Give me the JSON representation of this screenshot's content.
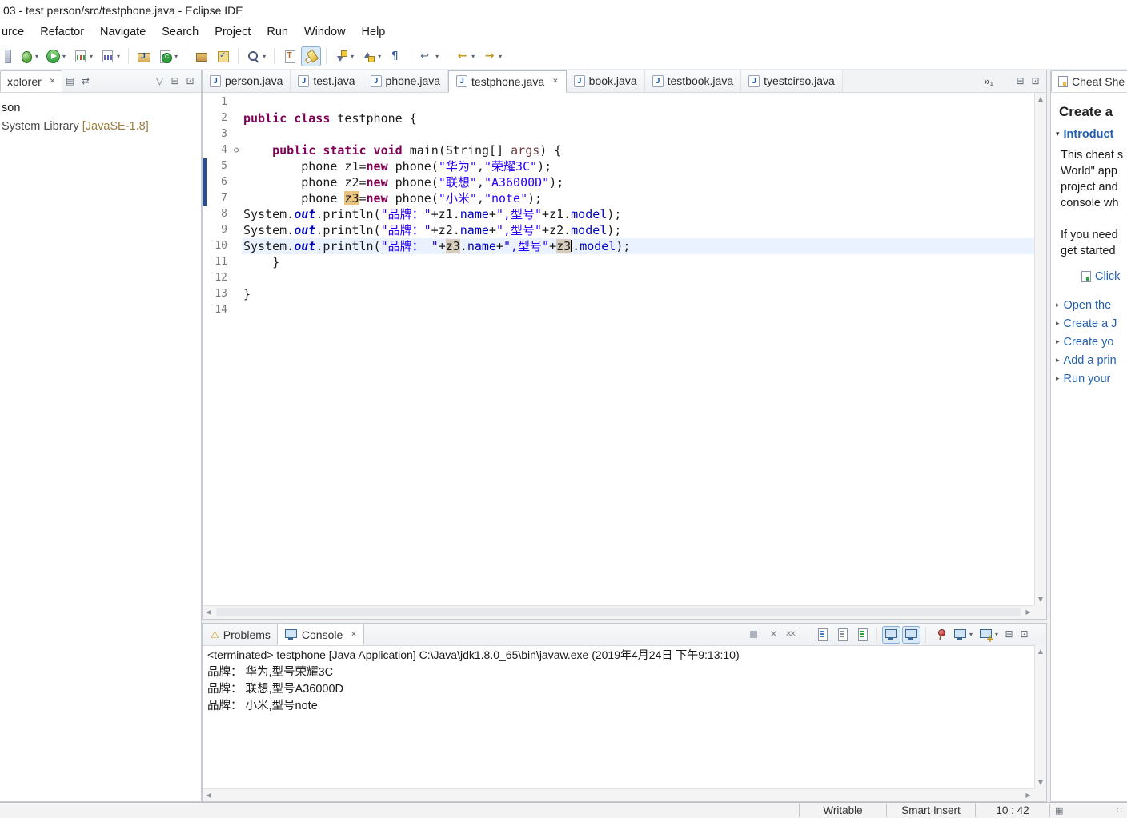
{
  "colors": {
    "keyword": "#7f0055",
    "string": "#2a00ff",
    "field": "#0000c0",
    "param": "#6a3e3e",
    "current_line": "#e9f2fe",
    "occurrence": "#d6cdbc",
    "occurrence_write": "#eac37e",
    "link": "#2361ae",
    "accent": "#3b6ea5"
  },
  "window": {
    "title": "03 - test person/src/testphone.java - Eclipse IDE"
  },
  "menubar": {
    "items": [
      "urce",
      "Refactor",
      "Navigate",
      "Search",
      "Project",
      "Run",
      "Window",
      "Help"
    ]
  },
  "icons": {
    "minimize": "⊟",
    "maximize": "⊡",
    "close": "✕",
    "view_menu": "▽",
    "dropdown": "▾",
    "fold_collapsed": "⊖",
    "scroll_up": "▲",
    "scroll_down": "▼",
    "scroll_left": "◀",
    "scroll_right": "▶",
    "warning": "⚠",
    "expand_arrow": "▸",
    "section_arrow": "▾",
    "grip": "∷",
    "progress": "▦"
  },
  "toolbar": {
    "items": [
      {
        "name": "new-wizard",
        "kind": "sliver"
      },
      {
        "name": "debug",
        "kind": "bug",
        "dropdown": true
      },
      {
        "name": "run",
        "kind": "run",
        "dropdown": true
      },
      {
        "name": "coverage",
        "kind": "coverage",
        "dropdown": true
      },
      {
        "name": "profile",
        "kind": "profile",
        "dropdown": true
      },
      {
        "sep": true
      },
      {
        "name": "new-java-project",
        "kind": "project"
      },
      {
        "name": "new-class",
        "kind": "class",
        "dropdown": true
      },
      {
        "sep": true
      },
      {
        "name": "new-package",
        "kind": "package"
      },
      {
        "name": "open-task",
        "kind": "task"
      },
      {
        "sep": true
      },
      {
        "name": "search",
        "kind": "search",
        "dropdown": true
      },
      {
        "sep": true
      },
      {
        "name": "open-type",
        "kind": "type"
      },
      {
        "name": "mark-occurrences",
        "kind": "mark",
        "pressed": true
      },
      {
        "sep": true
      },
      {
        "name": "next-annotation",
        "kind": "next",
        "dropdown": true
      },
      {
        "name": "previous-annotation",
        "kind": "prev",
        "dropdown": true
      },
      {
        "name": "show-whitespace",
        "kind": "pilcrow"
      },
      {
        "sep": true
      },
      {
        "name": "last-edit-location",
        "kind": "editloc",
        "dropdown": true
      },
      {
        "sep": true
      },
      {
        "name": "back",
        "kind": "back",
        "dropdown": true
      },
      {
        "name": "forward",
        "kind": "forward",
        "dropdown": true
      }
    ]
  },
  "package_explorer": {
    "tab_label": "xplorer",
    "left_icons": [
      {
        "name": "collapse-all-icon",
        "glyph": "▤"
      },
      {
        "name": "link-with-editor-icon",
        "glyph": "⇄"
      }
    ],
    "right_icons": [
      {
        "name": "view-menu-icon",
        "glyph": "▽"
      },
      {
        "name": "minimize-icon",
        "glyph": "⊟"
      },
      {
        "name": "maximize-icon",
        "glyph": "⊡"
      }
    ],
    "tree": [
      {
        "label": "son"
      },
      {
        "label": "System Library",
        "decoration": " [JavaSE-1.8]"
      }
    ]
  },
  "editor": {
    "overflow": "»₁",
    "tabs": [
      {
        "label": "person.java"
      },
      {
        "label": "test.java"
      },
      {
        "label": "phone.java"
      },
      {
        "label": "testphone.java",
        "active": true
      },
      {
        "label": "book.java"
      },
      {
        "label": "testbook.java"
      },
      {
        "label": "tyestcirso.java"
      }
    ],
    "lines": [
      {
        "n": 1,
        "seg": []
      },
      {
        "n": 2,
        "seg": [
          [
            "kw",
            "public class"
          ],
          [
            "pl",
            " testphone {"
          ]
        ]
      },
      {
        "n": 3,
        "seg": []
      },
      {
        "n": 4,
        "fold": true,
        "seg": [
          [
            "pl",
            "    "
          ],
          [
            "kw",
            "public static void"
          ],
          [
            "pl",
            " main(String[] "
          ],
          [
            "pm",
            "args"
          ],
          [
            "pl",
            ") {"
          ]
        ]
      },
      {
        "n": 5,
        "bar": true,
        "seg": [
          [
            "pl",
            "        phone z1="
          ],
          [
            "kw",
            "new"
          ],
          [
            "pl",
            " phone("
          ],
          [
            "st",
            "\"华为\""
          ],
          [
            "pl",
            ","
          ],
          [
            "st",
            "\"荣耀3C\""
          ],
          [
            "pl",
            ");"
          ]
        ]
      },
      {
        "n": 6,
        "bar": true,
        "seg": [
          [
            "pl",
            "        phone z2="
          ],
          [
            "kw",
            "new"
          ],
          [
            "pl",
            " phone("
          ],
          [
            "st",
            "\"联想\""
          ],
          [
            "pl",
            ","
          ],
          [
            "st",
            "\"A36000D\""
          ],
          [
            "pl",
            ");"
          ]
        ]
      },
      {
        "n": 7,
        "bar": true,
        "seg": [
          [
            "pl",
            "        phone "
          ],
          [
            "occw",
            "z3"
          ],
          [
            "pl",
            "="
          ],
          [
            "kw",
            "new"
          ],
          [
            "pl",
            " phone("
          ],
          [
            "st",
            "\"小米\""
          ],
          [
            "pl",
            ","
          ],
          [
            "st",
            "\"note\""
          ],
          [
            "pl",
            ");"
          ]
        ]
      },
      {
        "n": 8,
        "seg": [
          [
            "pl",
            "System."
          ],
          [
            "sf",
            "out"
          ],
          [
            "pl",
            ".println("
          ],
          [
            "st",
            "\"品牌：\""
          ],
          [
            "pl",
            "+z1."
          ],
          [
            "fl",
            "name"
          ],
          [
            "pl",
            "+"
          ],
          [
            "st",
            "\",型号\""
          ],
          [
            "pl",
            "+z1."
          ],
          [
            "fl",
            "model"
          ],
          [
            "pl",
            ");"
          ]
        ]
      },
      {
        "n": 9,
        "seg": [
          [
            "pl",
            "System."
          ],
          [
            "sf",
            "out"
          ],
          [
            "pl",
            ".println("
          ],
          [
            "st",
            "\"品牌：\""
          ],
          [
            "pl",
            "+z2."
          ],
          [
            "fl",
            "name"
          ],
          [
            "pl",
            "+"
          ],
          [
            "st",
            "\",型号\""
          ],
          [
            "pl",
            "+z2."
          ],
          [
            "fl",
            "model"
          ],
          [
            "pl",
            ");"
          ]
        ]
      },
      {
        "n": 10,
        "current": true,
        "seg": [
          [
            "pl",
            "System."
          ],
          [
            "sf",
            "out"
          ],
          [
            "pl",
            ".println("
          ],
          [
            "st",
            "\"品牌： \""
          ],
          [
            "pl",
            "+"
          ],
          [
            "occ",
            "z3"
          ],
          [
            "pl",
            "."
          ],
          [
            "fl",
            "name"
          ],
          [
            "pl",
            "+"
          ],
          [
            "st",
            "\",型号\""
          ],
          [
            "pl",
            "+"
          ],
          [
            "occ",
            "z3"
          ],
          [
            "caret",
            ""
          ],
          [
            "pl",
            "."
          ],
          [
            "fl",
            "model"
          ],
          [
            "pl",
            ");"
          ]
        ]
      },
      {
        "n": 11,
        "seg": [
          [
            "pl",
            "    }"
          ]
        ]
      },
      {
        "n": 12,
        "seg": []
      },
      {
        "n": 13,
        "seg": [
          [
            "pl",
            "}"
          ]
        ]
      },
      {
        "n": 14,
        "seg": []
      }
    ]
  },
  "cheat_sheet": {
    "tab_label": "Cheat She",
    "title": "Create a",
    "section": "Introduct",
    "paragraph1": [
      "This cheat s",
      "World\" app",
      "project and",
      "console wh"
    ],
    "paragraph2": [
      "If you need",
      "get started"
    ],
    "begin_link": "Click",
    "links": [
      "Open the",
      "Create a J",
      "Create yo",
      "Add a prin",
      "Run your"
    ]
  },
  "console": {
    "tabs": [
      {
        "label": "Problems",
        "icon": "warning"
      },
      {
        "label": "Console",
        "icon": "console",
        "active": true
      }
    ],
    "header": "<terminated> testphone [Java Application] C:\\Java\\jdk1.8.0_65\\bin\\javaw.exe (2019年4月24日 下午9:13:10)",
    "output": [
      "品牌： 华为,型号荣耀3C",
      "品牌： 联想,型号A36000D",
      "品牌： 小米,型号note"
    ],
    "toolbar_icons": [
      {
        "name": "terminate",
        "kind": "stop"
      },
      {
        "name": "remove-launch",
        "kind": "xgray"
      },
      {
        "name": "remove-all-terminated",
        "kind": "xxgray"
      },
      {
        "sep": true
      },
      {
        "name": "clear-console",
        "kind": "page"
      },
      {
        "name": "scroll-lock",
        "kind": "page2"
      },
      {
        "name": "word-wrap",
        "kind": "page3"
      },
      {
        "sep": true
      },
      {
        "name": "show-console-on-output",
        "kind": "monitor",
        "pressed": true
      },
      {
        "name": "show-console-on-error",
        "kind": "monitor",
        "pressed": true
      },
      {
        "sep": true
      },
      {
        "name": "pin-console",
        "kind": "pin"
      },
      {
        "name": "display-selected-console",
        "kind": "monitor",
        "dropdown": true
      },
      {
        "name": "open-console",
        "kind": "monitorplus",
        "dropdown": true
      }
    ]
  },
  "status_bar": {
    "writable": "Writable",
    "insert_mode": "Smart Insert",
    "cursor_position": "10 : 42"
  }
}
